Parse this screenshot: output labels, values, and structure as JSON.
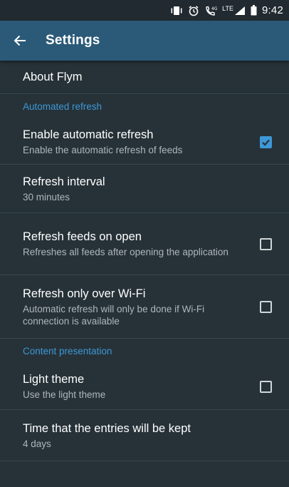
{
  "status_bar": {
    "time": "9:42",
    "network": "LTE",
    "icons": [
      "vibrate-icon",
      "alarm-icon",
      "call-wifi-icon",
      "signal-icon",
      "battery-icon"
    ]
  },
  "app_bar": {
    "title": "Settings",
    "back_icon": "arrow-left-icon"
  },
  "colors": {
    "status_bar": "#212A30",
    "app_bar": "#2B5A78",
    "background": "#263238",
    "accent": "#3E97D6",
    "divider": "#37464D"
  },
  "preferences": {
    "about": {
      "title": "About Flym"
    },
    "automated_refresh_header": "Automated refresh",
    "enable_refresh": {
      "title": "Enable automatic refresh",
      "summary": "Enable the automatic refresh of feeds",
      "checked": true
    },
    "refresh_interval": {
      "title": "Refresh interval",
      "summary": "30 minutes"
    },
    "refresh_on_open": {
      "title": "Refresh feeds on open",
      "summary": "Refreshes all feeds after opening the application",
      "checked": false
    },
    "wifi_only": {
      "title": "Refresh only over Wi-Fi",
      "summary": "Automatic refresh will only be done if Wi-Fi connection is available",
      "checked": false
    },
    "content_presentation_header": "Content presentation",
    "light_theme": {
      "title": "Light theme",
      "summary": "Use the light theme",
      "checked": false
    },
    "keep_time": {
      "title": "Time that the entries will be kept",
      "summary": "4 days"
    }
  }
}
